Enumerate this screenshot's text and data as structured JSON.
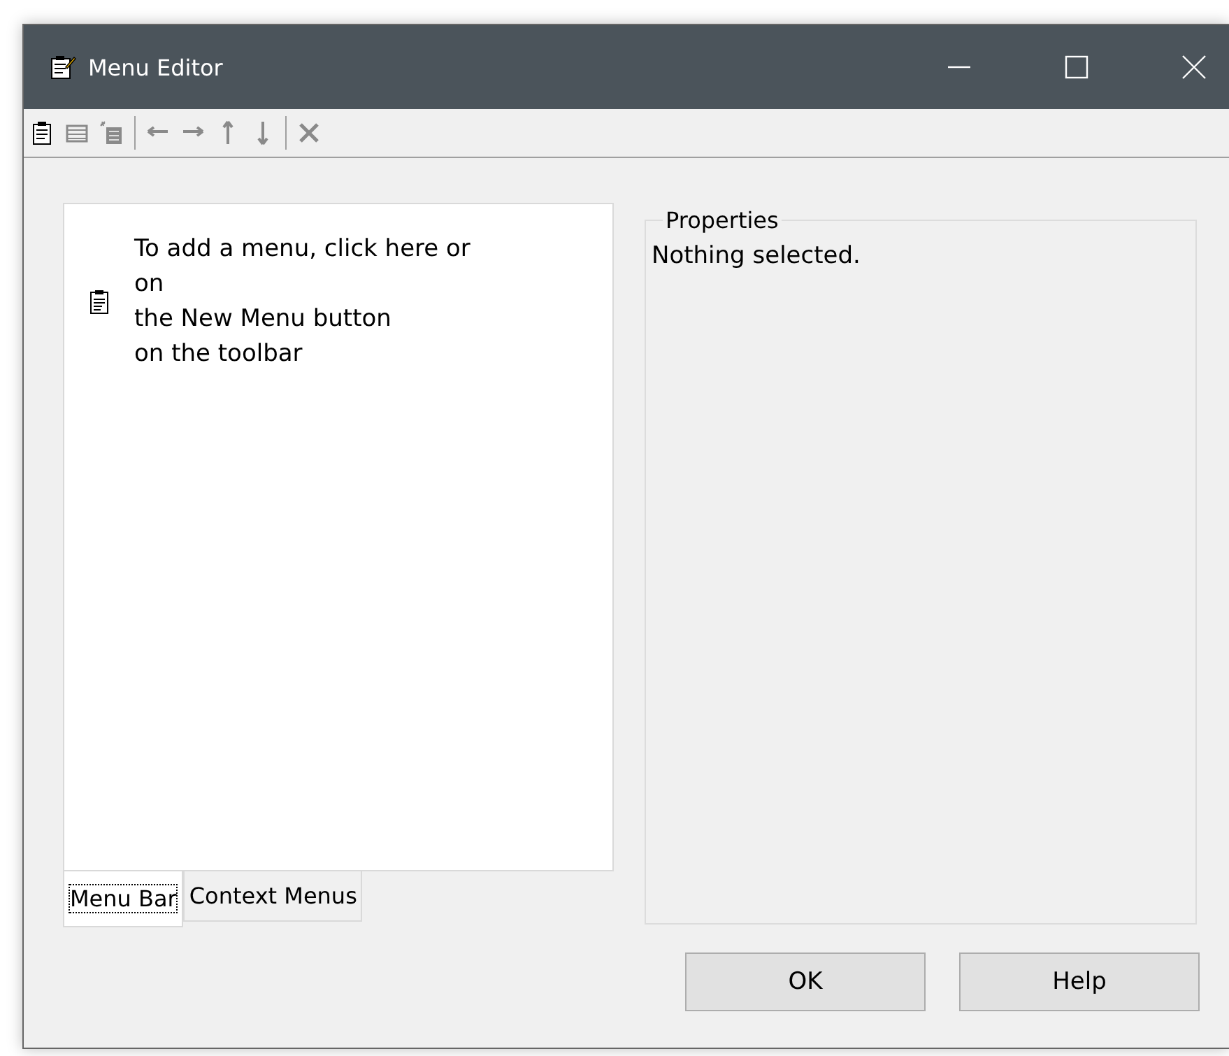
{
  "window": {
    "title": "Menu Editor"
  },
  "toolbar": [
    {
      "kind": "new-menu",
      "disabled": false
    },
    {
      "kind": "item",
      "disabled": true
    },
    {
      "kind": "sub-item",
      "disabled": true
    },
    {
      "kind": "separator"
    },
    {
      "kind": "left",
      "disabled": true
    },
    {
      "kind": "right",
      "disabled": true
    },
    {
      "kind": "up",
      "disabled": true
    },
    {
      "kind": "down",
      "disabled": true
    },
    {
      "kind": "separator"
    },
    {
      "kind": "delete",
      "disabled": true
    }
  ],
  "menu_tree": {
    "hint_lines": [
      "To add a menu, click here or",
      "on",
      "the New Menu button",
      "on the toolbar"
    ]
  },
  "tabs": [
    {
      "label": "Menu Bar",
      "selected": true
    },
    {
      "label": "Context Menus",
      "selected": false
    }
  ],
  "properties": {
    "title": "Properties",
    "message": "Nothing selected."
  },
  "buttons": [
    "OK",
    "Help"
  ]
}
